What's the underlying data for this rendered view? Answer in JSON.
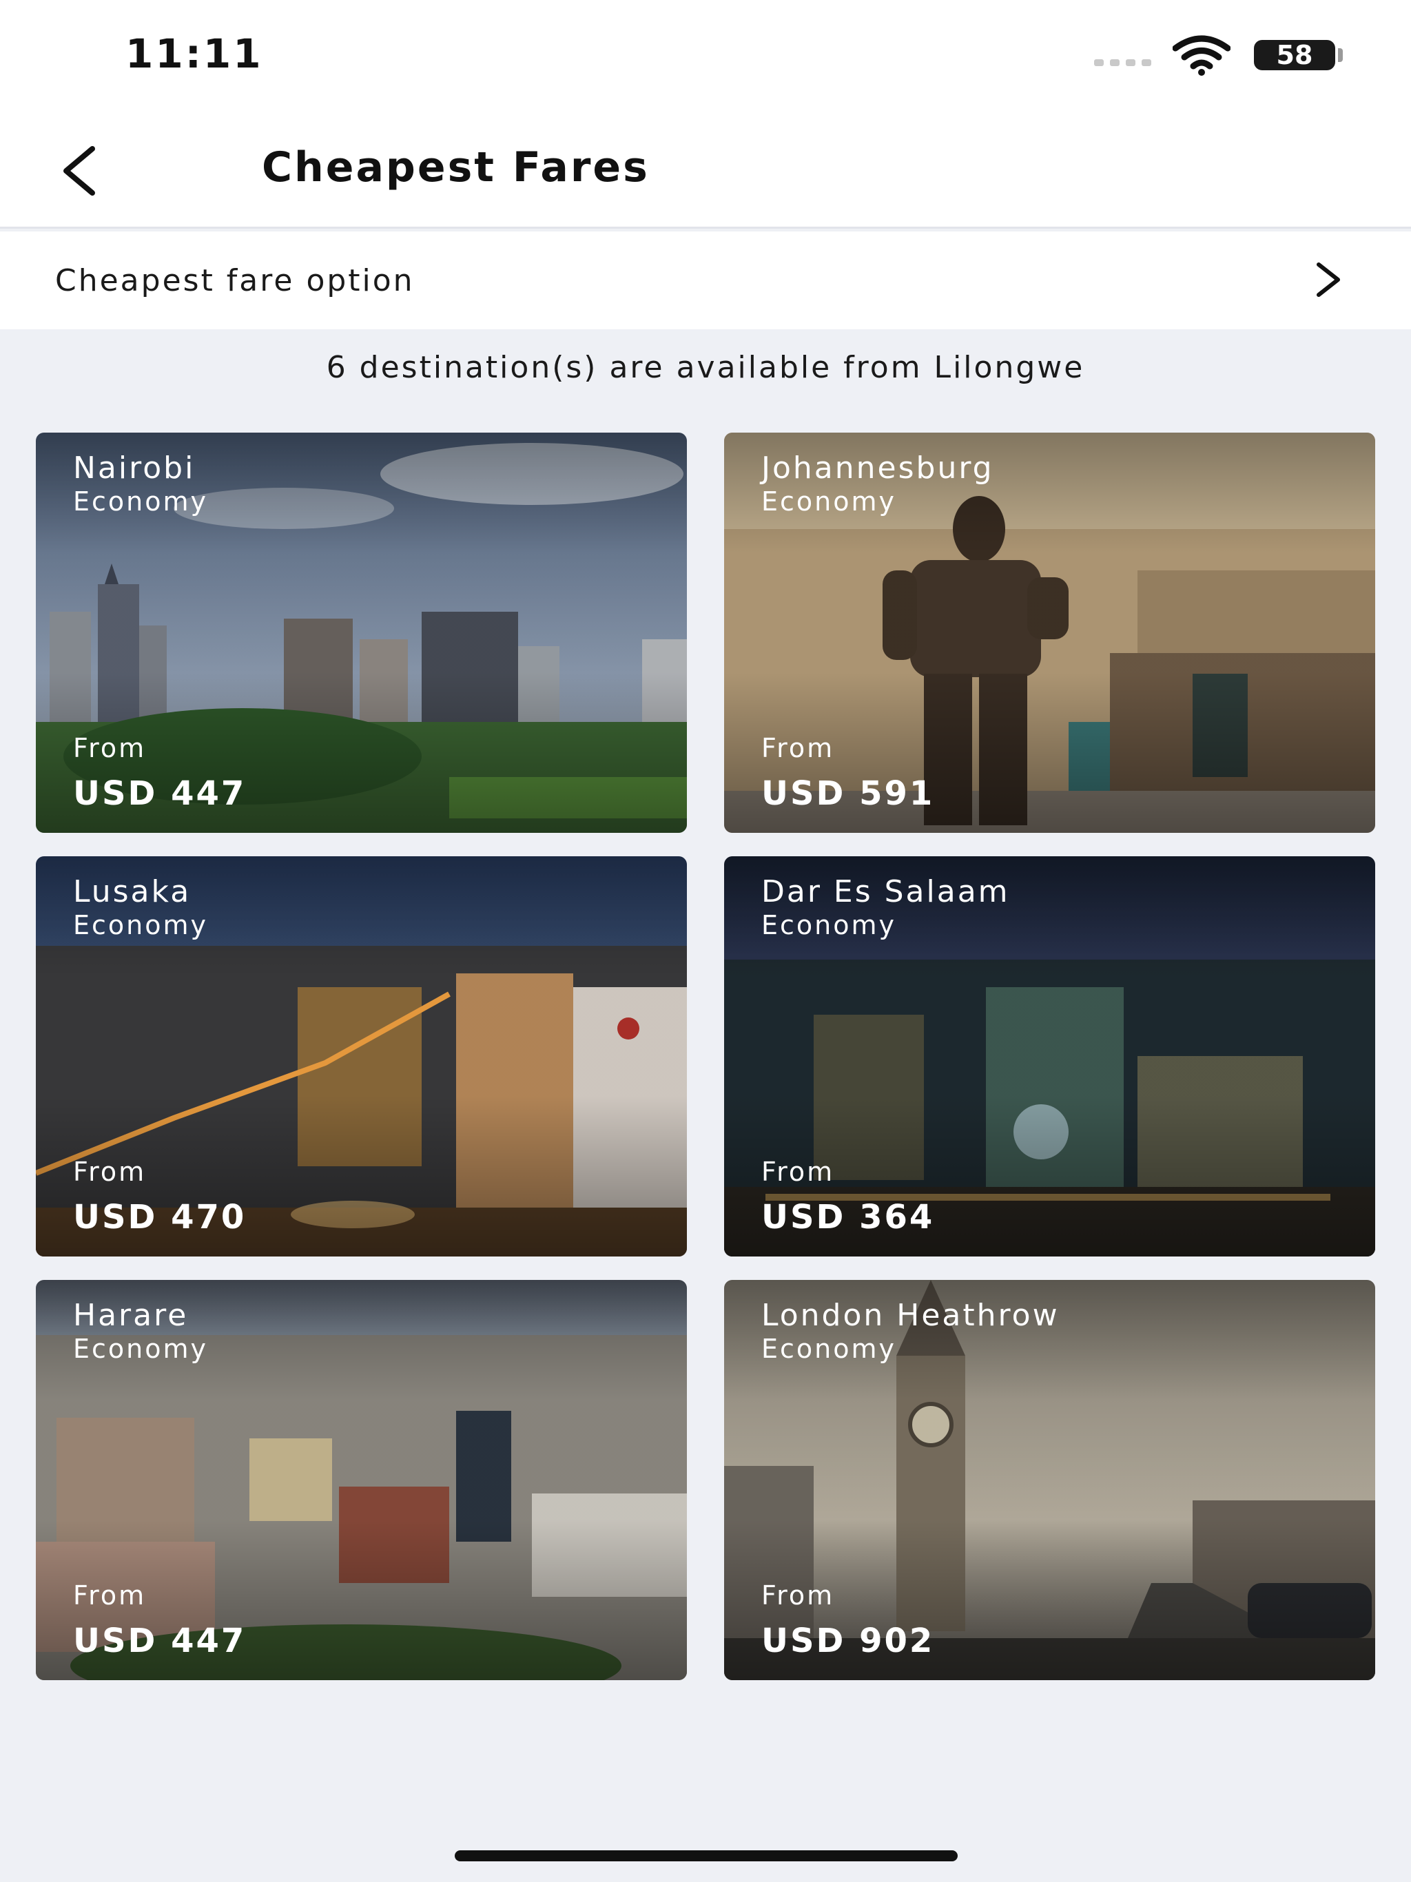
{
  "status_bar": {
    "time": "11:11",
    "battery": "58"
  },
  "header": {
    "title": "Cheapest Fares"
  },
  "fare_option": {
    "label": "Cheapest fare option"
  },
  "availability": "6 destination(s) are available from Lilongwe",
  "destinations": [
    {
      "city": "Nairobi",
      "cabin": "Economy",
      "from_label": "From",
      "price": "USD 447"
    },
    {
      "city": "Johannesburg",
      "cabin": "Economy",
      "from_label": "From",
      "price": "USD 591"
    },
    {
      "city": "Lusaka",
      "cabin": "Economy",
      "from_label": "From",
      "price": "USD 470"
    },
    {
      "city": "Dar Es Salaam",
      "cabin": "Economy",
      "from_label": "From",
      "price": "USD 364"
    },
    {
      "city": "Harare",
      "cabin": "Economy",
      "from_label": "From",
      "price": "USD 447"
    },
    {
      "city": "London Heathrow",
      "cabin": "Economy",
      "from_label": "From",
      "price": "USD 902"
    }
  ]
}
